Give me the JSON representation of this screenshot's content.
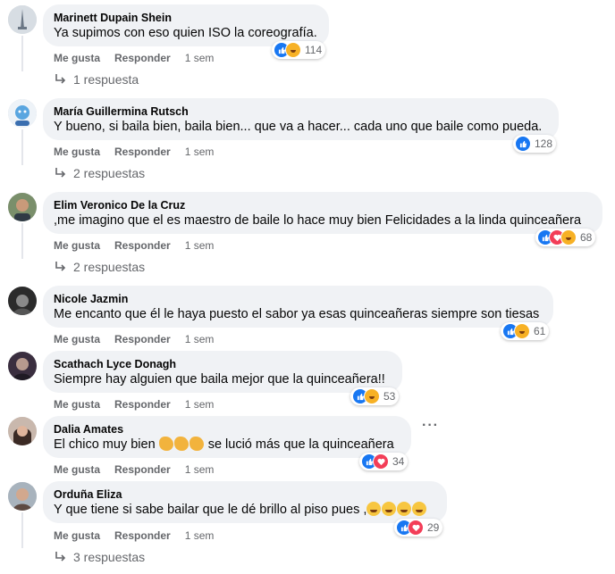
{
  "actions": {
    "like": "Me gusta",
    "reply": "Responder"
  },
  "comments": [
    {
      "author": "Marinett Dupain Shein",
      "text": "Ya supimos con eso quien ISO la coreografía.",
      "time": "1 sem",
      "reaction_count": "114",
      "reactions": [
        "like",
        "haha"
      ],
      "replies_label": "1 respuesta"
    },
    {
      "author": "María Guillermina Rutsch",
      "text": "Y bueno, si baila bien, baila bien... que va a hacer... cada uno que baile como pueda.",
      "time": "1 sem",
      "reaction_count": "128",
      "reactions": [
        "like"
      ],
      "replies_label": "2 respuestas"
    },
    {
      "author": "Elim Veronico De la Cruz",
      "text": ",me imagino que el es maestro de baile lo hace muy bien Felicidades a la linda quinceañera",
      "time": "1 sem",
      "reaction_count": "68",
      "reactions": [
        "like",
        "love",
        "haha"
      ],
      "replies_label": "2 respuestas"
    },
    {
      "author": "Nicole Jazmin",
      "text": "Me encanto que él le haya puesto el sabor ya esas quinceañeras siempre son tiesas",
      "time": "1 sem",
      "reaction_count": "61",
      "reactions": [
        "like",
        "haha"
      ]
    },
    {
      "author": "Scathach Lyce Donagh",
      "text": "Siempre hay alguien que baila mejor que la quinceañera!!",
      "time": "1 sem",
      "reaction_count": "53",
      "reactions": [
        "like",
        "haha"
      ]
    },
    {
      "author": "Dalia Amates",
      "text_before": "El chico muy bien",
      "text_after": "se lució más que la quinceañera",
      "time": "1 sem",
      "reaction_count": "34",
      "reactions": [
        "like",
        "love"
      ]
    },
    {
      "author": "Orduña Eliza",
      "text": "Y que tiene si sabe bailar que le dé brillo al piso pues ,",
      "time": "1 sem",
      "reaction_count": "29",
      "reactions": [
        "like",
        "love"
      ],
      "replies_label": "3 respuestas"
    }
  ],
  "icons": {
    "more": "more-options-icon",
    "reply_arrow": "reply-arrow-icon"
  },
  "colors": {
    "like": "#1877f2",
    "love": "#f33e58",
    "haha": "#f7b125",
    "bubble": "#f0f2f5",
    "meta": "#65676b"
  }
}
